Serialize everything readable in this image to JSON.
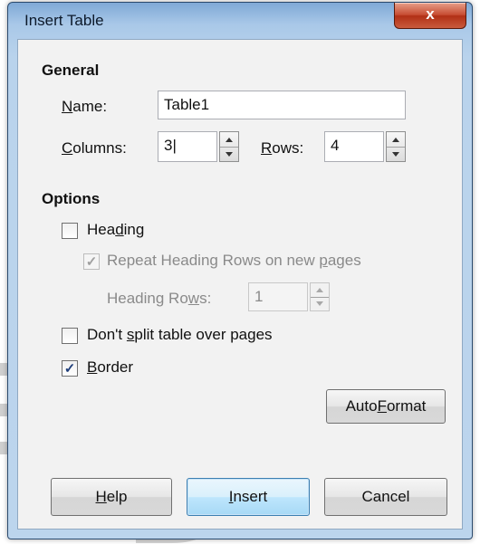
{
  "window": {
    "title": "Insert Table",
    "close_label": "x"
  },
  "general": {
    "heading": "General",
    "name_label": "Name:",
    "name_value": "Table1",
    "columns_label": "Columns:",
    "columns_value": "3",
    "rows_label": "Rows:",
    "rows_value": "4"
  },
  "options": {
    "heading": "Options",
    "heading_checkbox": {
      "label": "Heading",
      "checked": false
    },
    "repeat_heading": {
      "label": "Repeat Heading Rows on new pages",
      "checked": true,
      "enabled": false
    },
    "heading_rows_label": "Heading Rows:",
    "heading_rows_value": "1",
    "dont_split": {
      "label": "Don't split table over pages",
      "checked": false
    },
    "border": {
      "label": "Border",
      "checked": true
    }
  },
  "buttons": {
    "autoformat": "AutoFormat",
    "help": "Help",
    "insert": "Insert",
    "cancel": "Cancel"
  },
  "colors": {
    "frame": "#b9d3ec",
    "client": "#f2f2f2",
    "close": "#c74c32"
  },
  "icons": [
    "close-icon",
    "spin-up-icon",
    "spin-down-icon",
    "check-icon"
  ]
}
